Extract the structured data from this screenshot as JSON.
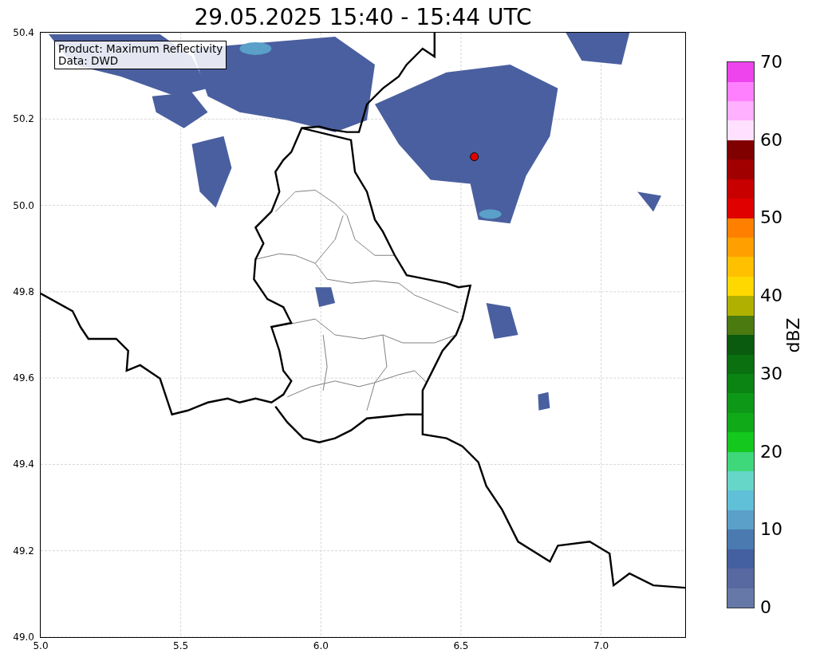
{
  "title": "29.05.2025 15:40 - 15:44 UTC",
  "info_box": [
    "Product: Maximum Reflectivity",
    "Data: DWD"
  ],
  "map": {
    "xticks": [
      "5.0",
      "5.5",
      "6.0",
      "6.5",
      "7.0"
    ],
    "yticks": [
      "50.4",
      "50.2",
      "50.0",
      "49.8",
      "49.6",
      "49.4",
      "49.2",
      "49.0"
    ]
  },
  "colorbar": {
    "label": "dBZ",
    "ticks": [
      "70",
      "60",
      "50",
      "40",
      "30",
      "20",
      "10",
      "0"
    ],
    "bins": [
      {
        "color": "#6678a8"
      },
      {
        "color": "#5868a0"
      },
      {
        "color": "#4460a0"
      },
      {
        "color": "#4a7ab0"
      },
      {
        "color": "#5aa0c8"
      },
      {
        "color": "#60c0d8"
      },
      {
        "color": "#66d6c8"
      },
      {
        "color": "#3ed77a"
      },
      {
        "color": "#14c81e"
      },
      {
        "color": "#10aa18"
      },
      {
        "color": "#0e9818"
      },
      {
        "color": "#0c8414"
      },
      {
        "color": "#0a7010"
      },
      {
        "color": "#0a5a10"
      },
      {
        "color": "#4a7a10"
      },
      {
        "color": "#b0b000"
      },
      {
        "color": "#ffd800"
      },
      {
        "color": "#ffc000"
      },
      {
        "color": "#ffa000"
      },
      {
        "color": "#ff8000"
      },
      {
        "color": "#e00000"
      },
      {
        "color": "#c80000"
      },
      {
        "color": "#a00000"
      },
      {
        "color": "#800000"
      },
      {
        "color": "#ffe0ff"
      },
      {
        "color": "#ffb0ff"
      },
      {
        "color": "#ff80ff"
      },
      {
        "color": "#ee44ee"
      }
    ]
  }
}
